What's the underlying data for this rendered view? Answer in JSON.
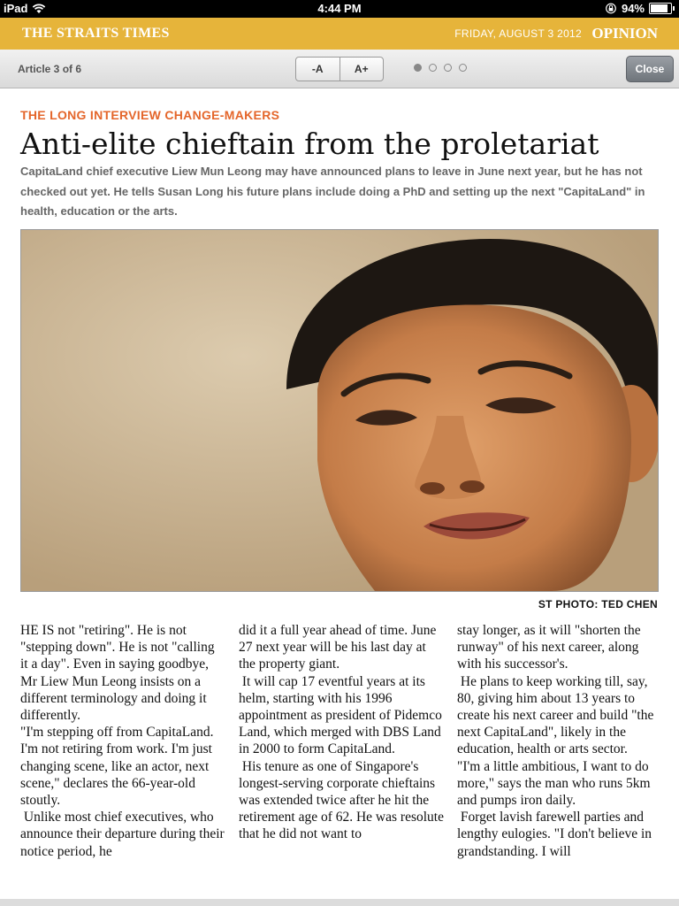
{
  "status_bar": {
    "device": "iPad",
    "time": "4:44 PM",
    "battery": "94%",
    "battery_level": 0.94
  },
  "masthead": {
    "brand": "THE STRAITS TIMES",
    "date": "FRIDAY, AUGUST 3 2012",
    "section": "OPINION"
  },
  "toolbar": {
    "article_position": "Article 3 of 6",
    "font_decrease": "-A",
    "font_increase": "A+",
    "page_count": 4,
    "active_page": 1,
    "close_label": "Close"
  },
  "article": {
    "kicker": "THE LONG INTERVIEW CHANGE-MAKERS",
    "headline": "Anti-elite chieftain from the proletariat",
    "standfirst": "CapitaLand chief executive Liew Mun Leong may have announced plans to leave in June next year, but he has not checked out yet. He tells Susan Long his future plans include doing a PhD and setting up the next \"CapitaLand\" in health, education or the arts.",
    "photo_credit": "ST PHOTO: TED CHEN",
    "columns": [
      [
        "HE IS not \"retiring\". He is not \"stepping down\". He is not \"calling it a day\". Even in saying goodbye, Mr Liew Mun Leong insists on a different terminology and doing it differently.",
        "\"I'm stepping off from CapitaLand. I'm not retiring from work. I'm just changing scene, like an actor, next scene,\" declares the 66-year-old stoutly.",
        " Unlike most chief executives, who announce their departure during their notice period, he"
      ],
      [
        "did it a full year ahead of time. June 27 next year will be his last day at the property giant.",
        " It will cap 17 eventful years at its helm, starting with his 1996 appointment as president of Pidemco Land, which merged with DBS Land in 2000 to form CapitaLand.",
        " His tenure as one of Singapore's longest-serving corporate chieftains was extended twice after he hit the retirement age of 62. He was resolute that he did not want to"
      ],
      [
        "stay longer, as it will \"shorten the runway\" of his next career, along with his successor's.",
        " He plans to keep working till, say, 80, giving him about 13 years to create his next career and build \"the next CapitaLand\", likely in the education, health or arts sector.",
        "\"I'm a little ambitious, I want to do more,\" says the man who runs 5km and pumps iron daily.",
        " Forget lavish farewell parties and lengthy eulogies. \"I don't believe in grandstanding. I will"
      ]
    ]
  },
  "icons": {
    "wifi": "wifi-icon",
    "lock": "rotation-lock-icon",
    "battery": "battery-icon"
  }
}
